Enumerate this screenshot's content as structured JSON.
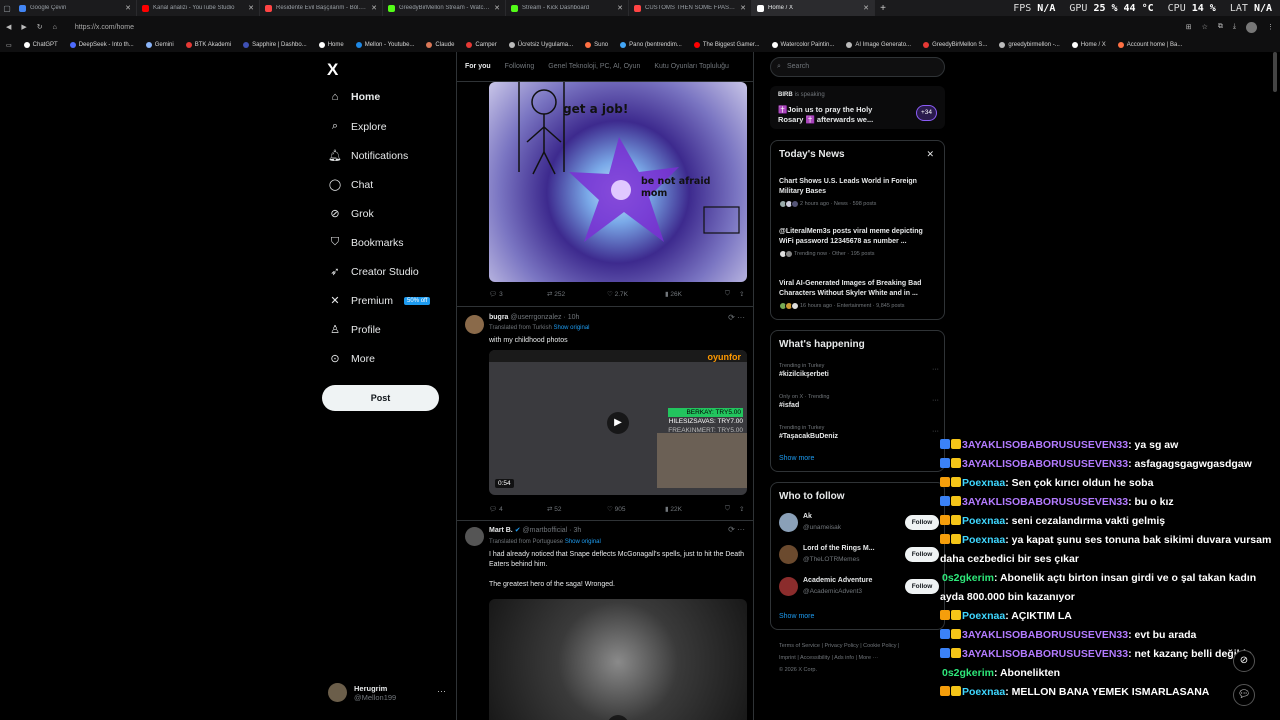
{
  "browser": {
    "tabs": [
      {
        "title": "Google Çeviri",
        "color": "#4285f4"
      },
      {
        "title": "Kanal analizi - YouTube Studio",
        "color": "#ff0000"
      },
      {
        "title": "Residente Evil Başçılarım - Böl... 2",
        "color": "#ff4444"
      },
      {
        "title": "GreedyBirMellon Stream - Watch...",
        "color": "#53fc18"
      },
      {
        "title": "Stream - Kick Dashboard",
        "color": "#53fc18"
      },
      {
        "title": "CUSTOMS THEN SOME FPAS AFT...",
        "color": "#ff4444"
      },
      {
        "title": "Home / X",
        "color": "#ffffff"
      }
    ],
    "perf": {
      "fps_label": "FPS",
      "fps": "N/A",
      "gpu_label": "GPU",
      "gpu": "25 % 44 °C",
      "cpu_label": "CPU",
      "cpu": "14 %",
      "lat_label": "LAT",
      "lat": "N/A"
    },
    "url": "https://x.com/home",
    "bookmarks": [
      {
        "label": "ChatGPT",
        "color": "#ffffff"
      },
      {
        "label": "DeepSeek - Into th...",
        "color": "#4d6bfe"
      },
      {
        "label": "Gemini",
        "color": "#8ab4f8"
      },
      {
        "label": "BTK Akademi",
        "color": "#e53935"
      },
      {
        "label": "Sapphire | Dashbo...",
        "color": "#3f51b5"
      },
      {
        "label": "Home",
        "color": "#ffffff"
      },
      {
        "label": "Mellon - Youtube...",
        "color": "#1e88e5"
      },
      {
        "label": "Claude",
        "color": "#d97757"
      },
      {
        "label": "Camper",
        "color": "#e53935"
      },
      {
        "label": "Ücretsiz Uygulama...",
        "color": "#bbbbbb"
      },
      {
        "label": "Suno",
        "color": "#ff7043"
      },
      {
        "label": "Pano (bentrendim...",
        "color": "#42a5f5"
      },
      {
        "label": "The Biggest Gamer...",
        "color": "#ff0000"
      },
      {
        "label": "Watercolor Paintin...",
        "color": "#ffffff"
      },
      {
        "label": "AI Image Generato...",
        "color": "#bbbbbb"
      },
      {
        "label": "GreedyBirMellon S...",
        "color": "#e53935"
      },
      {
        "label": "greedybirmellon -...",
        "color": "#bbbbbb"
      },
      {
        "label": "Home / X",
        "color": "#ffffff"
      },
      {
        "label": "Account home | Ba...",
        "color": "#ff7043"
      }
    ]
  },
  "nav": {
    "logo": "X",
    "items": [
      {
        "label": "Home",
        "icon": "⌂",
        "icon_name": "home-icon"
      },
      {
        "label": "Explore",
        "icon": "⌕",
        "icon_name": "search-icon"
      },
      {
        "label": "Notifications",
        "icon": "🔔︎",
        "icon_name": "bell-icon"
      },
      {
        "label": "Chat",
        "icon": "◯",
        "icon_name": "chat-icon"
      },
      {
        "label": "Grok",
        "icon": "⊘",
        "icon_name": "grok-icon"
      },
      {
        "label": "Bookmarks",
        "icon": "⛉",
        "icon_name": "bookmark-icon"
      },
      {
        "label": "Creator Studio",
        "icon": "➶",
        "icon_name": "rocket-icon"
      },
      {
        "label": "Premium",
        "icon": "✕",
        "icon_name": "x-logo-icon"
      },
      {
        "label": "Profile",
        "icon": "♙",
        "icon_name": "person-icon"
      },
      {
        "label": "More",
        "icon": "⊙",
        "icon_name": "more-circle-icon"
      }
    ],
    "premium_badge": "50% off",
    "post_label": "Post",
    "me_name": "Herugrim",
    "me_handle": "@Mellon199"
  },
  "feed": {
    "tabs": [
      "For you",
      "Following",
      "Genel Teknoloji, PC, AI, Oyun",
      "Kutu Oyunları Topluluğu"
    ],
    "post1": {
      "meme_top": "get a job!",
      "meme_bottom": "be not afraid mom",
      "replies": "3",
      "reposts": "252",
      "likes": "2.7K",
      "views": "26K"
    },
    "post2": {
      "name": "bugra",
      "handle": "@userrgonzalez · 10h",
      "translated": "Translated from Turkish",
      "show_original": "Show original",
      "text": "with my childhood photos",
      "duration": "0:54",
      "overlay_brand": "oyunfor",
      "overlay_l1": "BERKAY: TRY5.00",
      "overlay_l2": "HILESIZSAVAS: TRY7.00",
      "overlay_l3": "FREAKINMERT: TRY5.00",
      "replies": "4",
      "reposts": "52",
      "likes": "905",
      "views": "22K"
    },
    "post3": {
      "name": "Mart B.",
      "handle": "@martbofficial · 3h",
      "translated": "Translated from Portuguese",
      "show_original": "Show original",
      "text1": "I had already noticed that Snape deflects McGonagall's spells, just to hit the Death Eaters behind him.",
      "text2": "The greatest hero of the saga! Wronged."
    }
  },
  "right": {
    "search_placeholder": "Search",
    "space": {
      "host": "BIRB",
      "status": "is speaking",
      "title": "✝️Join us to pray the Holy Rosary ✝️ afterwards we...",
      "count": "+34"
    },
    "news_title": "Today's News",
    "news": [
      {
        "title": "Chart Shows U.S. Leads World in Foreign Military Bases",
        "meta": "2 hours ago · News · 598 posts"
      },
      {
        "title": "@LiteralMem3s posts viral meme depicting WiFi password 12345678 as number ...",
        "meta": "Trending now · Other · 195 posts"
      },
      {
        "title": "Viral AI-Generated Images of Breaking Bad Characters Without Skyler White and in ...",
        "meta": "16 hours ago · Entertainment · 9,845 posts"
      }
    ],
    "happening_title": "What's happening",
    "trends": [
      {
        "context": "Trending in Turkey",
        "name": "#kizilcikşerbeti"
      },
      {
        "context": "Only on X · Trending",
        "name": "#isfad"
      },
      {
        "context": "Trending in Turkey",
        "name": "#TaşacakBuDeniz"
      }
    ],
    "show_more": "Show more",
    "wtf_title": "Who to follow",
    "follow": [
      {
        "name": "Ak",
        "handle": "@unameisak",
        "color": "#8aa0b8"
      },
      {
        "name": "Lord of the Rings M...",
        "handle": "@TheLOTRMemes",
        "color": "#6b4a2e"
      },
      {
        "name": "Academic Adventure",
        "handle": "@AcademicAdvent3",
        "color": "#8b2c2c"
      }
    ],
    "follow_label": "Follow",
    "footer1": "Terms of Service  |  Privacy Policy  |  Cookie Policy  |",
    "footer2": "Imprint  |  Accessibility  |  Ads info  |  More ···",
    "footer3": "© 2026 X Corp."
  },
  "chat": [
    {
      "user": "3AYAKLISOBABORUSUSEVEN33",
      "cls": "u1",
      "text": ": ya sg aw"
    },
    {
      "user": "3AYAKLISOBABORUSUSEVEN33",
      "cls": "u1",
      "text": ": asfagagsgagwgasdgaw"
    },
    {
      "user": "Poexnaa",
      "cls": "u2",
      "text": ": Sen çok kırıcı oldun he soba"
    },
    {
      "user": "3AYAKLISOBABORUSUSEVEN33",
      "cls": "u1",
      "text": ": bu o kız"
    },
    {
      "user": "Poexnaa",
      "cls": "u2",
      "text": ": seni cezalandırma vakti gelmiş"
    },
    {
      "user": "Poexnaa",
      "cls": "u2",
      "text": ": ya kapat şunu ses tonuna bak sikimi duvara vursam daha cezbedici bir ses çıkar"
    },
    {
      "user": "0s2gkerim",
      "cls": "u3",
      "text": ": Abonelik açtı birton insan girdi ve o şal takan kadın ayda 800.000 bin kazanıyor"
    },
    {
      "user": "Poexnaa",
      "cls": "u2",
      "text": ": AÇIKTIM LA"
    },
    {
      "user": "3AYAKLISOBABORUSUSEVEN33",
      "cls": "u1",
      "text": ": evt bu arada"
    },
    {
      "user": "3AYAKLISOBABORUSUSEVEN33",
      "cls": "u1",
      "text": ": net kazanç belli değilde"
    },
    {
      "user": "0s2gkerim",
      "cls": "u3",
      "text": ": Abonelikten"
    },
    {
      "user": "Poexnaa",
      "cls": "u2",
      "text": ": MELLON BANA YEMEK ISMARLASANA"
    }
  ]
}
